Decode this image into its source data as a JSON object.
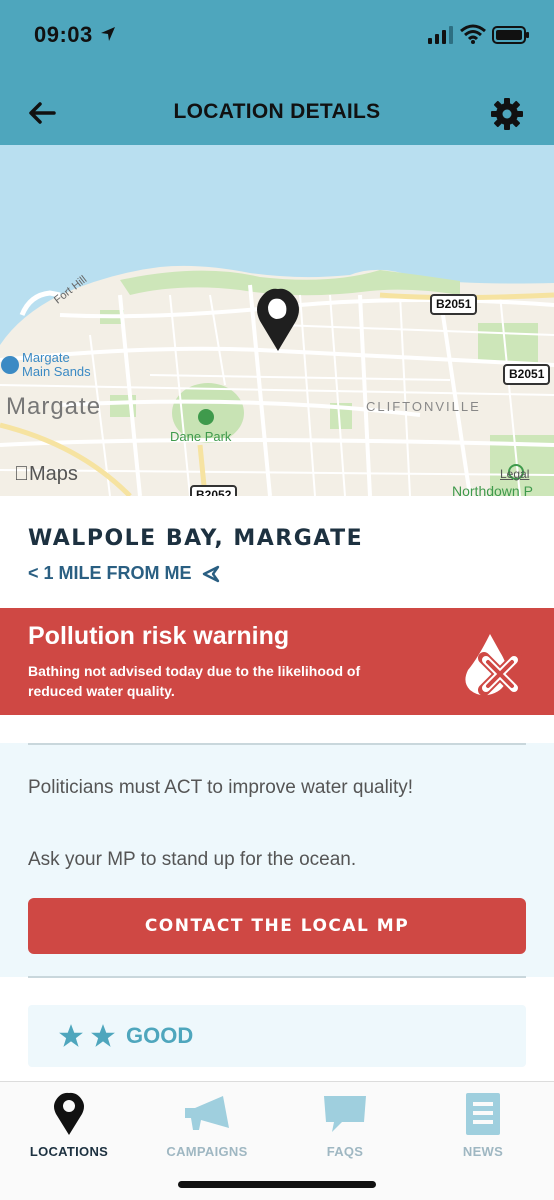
{
  "status_bar": {
    "time": "09:03"
  },
  "header": {
    "title": "LOCATION DETAILS"
  },
  "map": {
    "labels": {
      "margate": "Margate",
      "margate_sands_line1": "Margate",
      "margate_sands_line2": "Main Sands",
      "dane_park": "Dane Park",
      "cliftonville": "CLIFTONVILLE",
      "fort_hill": "Fort Hill",
      "northdown": "Northdown P",
      "legal": "Legal",
      "maps": "Maps"
    },
    "roads": {
      "b2051_top": "B2051",
      "b2051_right": "B2051",
      "b2052": "B2052"
    }
  },
  "location": {
    "name": "WALPOLE BAY, MARGATE",
    "distance": "< 1 MILE FROM ME"
  },
  "warning": {
    "title": "Pollution risk warning",
    "text": "Bathing not advised today due to the likelihood of reduced water quality."
  },
  "campaign": {
    "line1": "Politicians must ACT to improve water quality!",
    "line2": "Ask your MP to stand up for the ocean.",
    "button_label": "CONTACT THE LOCAL MP"
  },
  "rating": {
    "stars": 2,
    "label": "GOOD"
  },
  "tabs": [
    {
      "label": "LOCATIONS",
      "icon": "map-pin-icon",
      "active": true
    },
    {
      "label": "CAMPAIGNS",
      "icon": "megaphone-icon",
      "active": false
    },
    {
      "label": "FAQS",
      "icon": "chat-bubble-icon",
      "active": false
    },
    {
      "label": "NEWS",
      "icon": "news-icon",
      "active": false
    }
  ],
  "colors": {
    "header_bg": "#4ea6bd",
    "warning_bg": "#cf4844",
    "button_bg": "#cf4844",
    "rating_accent": "#4ea6bd",
    "title_text": "#1d3140"
  }
}
